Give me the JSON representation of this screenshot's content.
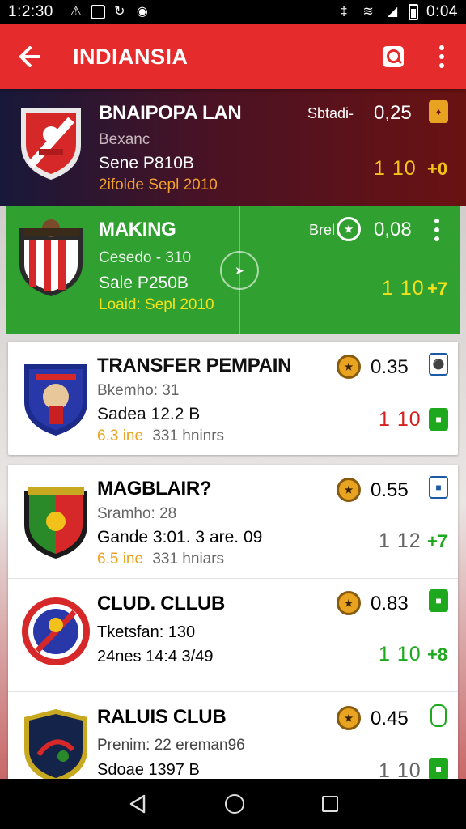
{
  "status_bar": {
    "time": "1:2:30",
    "time_right": "0:04",
    "icons": [
      "alert-icon",
      "image-icon",
      "sync-icon",
      "globe-icon",
      "bluetooth-icon",
      "wifi-icon",
      "signal-icon",
      "battery-icon"
    ]
  },
  "app_bar": {
    "title": "INDIANSIA",
    "icons": [
      "back-arrow-icon",
      "search-icon",
      "more-vert-icon"
    ]
  },
  "clubs": [
    {
      "name": "BNAIPOPA LAN",
      "line1": "Bexanc",
      "line2": "Sene P810B",
      "line3": "2ifolde Sepl 2010",
      "right_label": "Sbtadi-",
      "right_value": "0,25",
      "score": "1 10",
      "delta": "+0",
      "background": "dark-maroon"
    },
    {
      "name": "MAKING",
      "line1": "Cesedo - 310",
      "line2": "Sale P250B",
      "line3": "Loaid: Sepl 2010",
      "right_label": "Brel",
      "right_value": "0,08",
      "score": "1 10",
      "delta": "+7",
      "background": "green"
    },
    {
      "name": "TRANSFER PEMPAIN",
      "line1": "Bkemho: 31",
      "line2": "Sadea 12.2 B",
      "line3_accent": "6.3 ine",
      "line3": "331 hninrs",
      "right_value": "0.35",
      "score": "1 10",
      "background": "white"
    },
    {
      "name": "MAGBLAIR?",
      "line1": "Sramho: 28",
      "line2": "Gande 3:01. 3 are. 09",
      "line3_accent": "6.5 ine",
      "line3": "331 hniars",
      "right_value": "0.55",
      "score": "1 12",
      "delta": "+7",
      "background": "white"
    },
    {
      "name": "CLUD. CLLUB",
      "line1": "Tketsfan: 130",
      "line2": "24nes 14:4 3/49",
      "right_value": "0.83",
      "score": "1 10",
      "delta": "+8",
      "background": "white"
    },
    {
      "name": "RALUIS CLUB",
      "line1": "Prenim: 22 ereman96",
      "line2": "Sdoae 1397 B",
      "right_value": "0.45",
      "score": "1 10",
      "background": "white"
    }
  ],
  "colors": {
    "app_bar": "#e52b2b",
    "green_card": "#30a030",
    "accent_yellow": "#f2c21a",
    "score_red": "#d42020",
    "score_green": "#1ea81e"
  },
  "nav_bar": {
    "icons": [
      "nav-back-icon",
      "nav-home-icon",
      "nav-recents-icon"
    ]
  }
}
